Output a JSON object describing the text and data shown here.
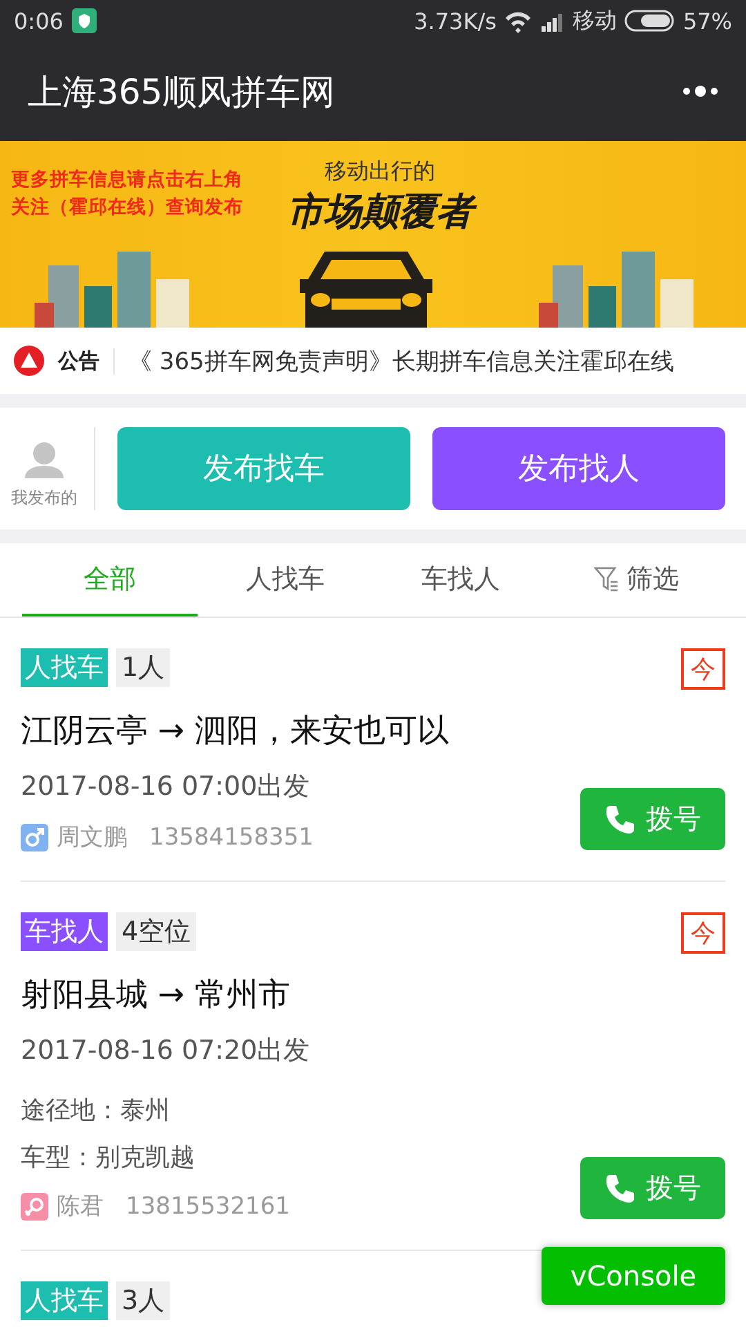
{
  "status_bar": {
    "time": "0:06",
    "speed": "3.73K/s",
    "carrier": "移动",
    "battery": "57%"
  },
  "nav": {
    "title": "上海365顺风拼车网"
  },
  "banner": {
    "lines": [
      "更多拼车信息请点击右上角",
      "关注（霍邱在线）查询发布"
    ],
    "subtitle": "移动出行的",
    "headline": "市场颠覆者"
  },
  "notice": {
    "label": "公告",
    "text": "《 365拼车网免责声明》长期拼车信息关注霍邱在线"
  },
  "publish": {
    "mine_label": "我发布的",
    "buttons": [
      {
        "label": "发布找车",
        "color": "#1dbdb0"
      },
      {
        "label": "发布找人",
        "color": "#8a4ffe"
      }
    ]
  },
  "tabs": [
    {
      "label": "全部",
      "kind": "tab",
      "selected": true
    },
    {
      "label": "人找车",
      "kind": "tab",
      "selected": false
    },
    {
      "label": "车找人",
      "kind": "tab",
      "selected": false
    },
    {
      "label": "筛选",
      "kind": "filter",
      "selected": false
    }
  ],
  "listings": [
    {
      "type_tag": "人找车",
      "color": "#1dbdb0",
      "seats": "1人",
      "today": "今",
      "route": "江阴云亭 → 泗阳，来安也可以",
      "departure": "2017-08-16 07:00出发",
      "kind": "male",
      "name": "周文鹏",
      "phone": "13584158351",
      "call_label": "拨号"
    },
    {
      "type_tag": "车找人",
      "color": "#8a4ffe",
      "seats": "4空位",
      "today": "今",
      "route": "射阳县城 → 常州市",
      "departure": "2017-08-16 07:20出发",
      "details": [
        "途径地：泰州",
        "车型：别克凯越"
      ],
      "kind": "female",
      "name": "陈君",
      "phone": "13815532161",
      "call_label": "拨号"
    },
    {
      "type_tag": "人找车",
      "color": "#1dbdb0",
      "seats": "3人"
    }
  ],
  "fab": {
    "label": "vConsole"
  }
}
